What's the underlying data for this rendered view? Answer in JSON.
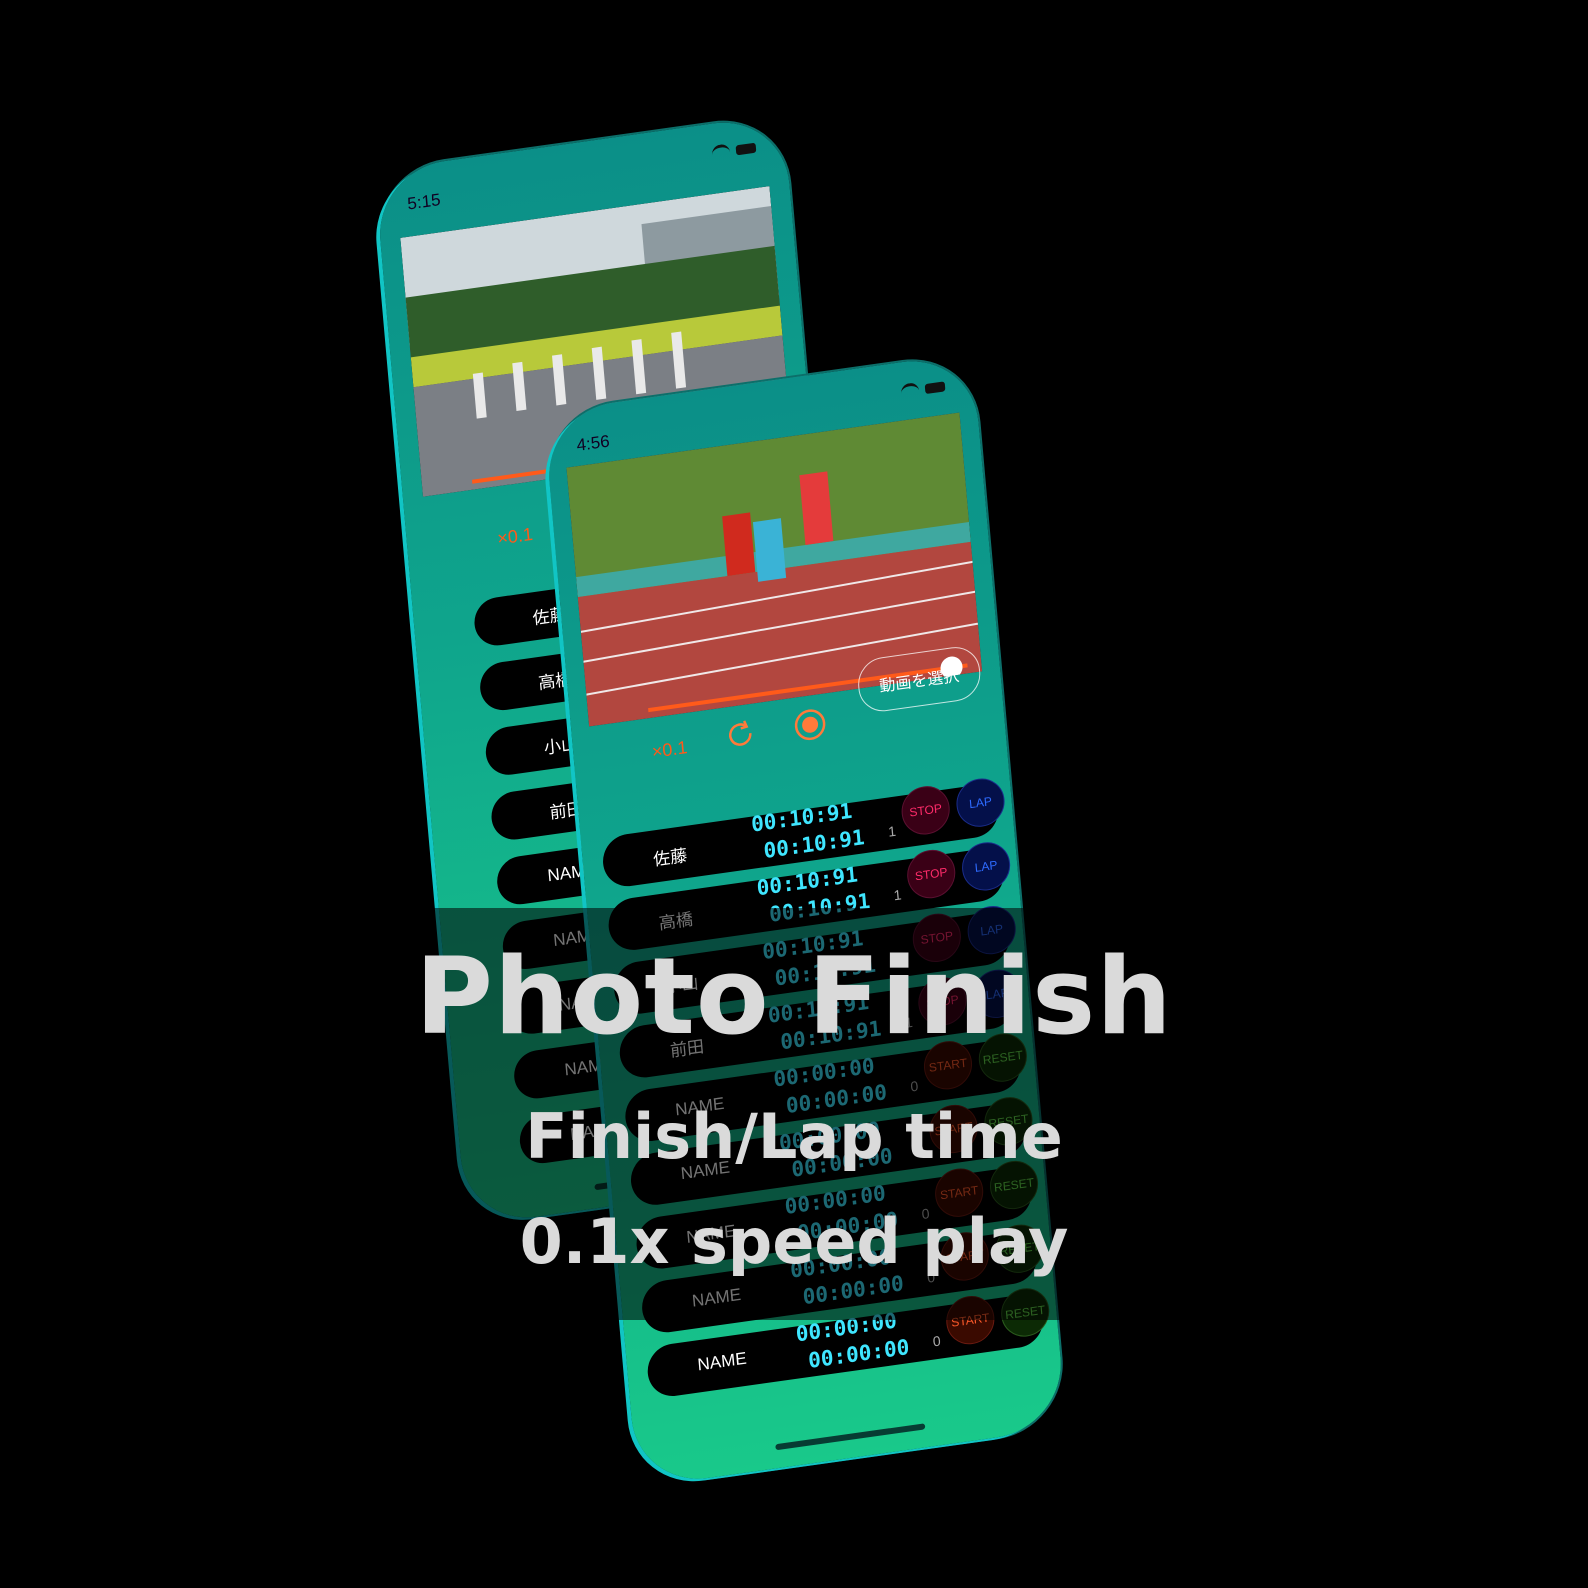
{
  "back_phone": {
    "status_time": "5:15",
    "speed": "×0.1",
    "rows": [
      "佐藤",
      "高橋",
      "小山",
      "前田",
      "NAME",
      "NAME",
      "NAME",
      "NAME",
      "NAME"
    ]
  },
  "front_phone": {
    "status_time": "4:56",
    "speed": "×0.1",
    "select_video_label": "動画を選択",
    "scrub_progress": 0.95,
    "rows": [
      {
        "name": "佐藤",
        "time_main": "00:10:91",
        "time_lap": "00:10:91",
        "lap_count": "1",
        "btn_left": "STOP",
        "btn_right": "LAP"
      },
      {
        "name": "高橋",
        "time_main": "00:10:91",
        "time_lap": "00:10:91",
        "lap_count": "1",
        "btn_left": "STOP",
        "btn_right": "LAP"
      },
      {
        "name": "小山",
        "time_main": "00:10:91",
        "time_lap": "00:10:91",
        "lap_count": "1",
        "btn_left": "STOP",
        "btn_right": "LAP"
      },
      {
        "name": "前田",
        "time_main": "00:10:91",
        "time_lap": "00:10:91",
        "lap_count": "1",
        "btn_left": "STOP",
        "btn_right": "LAP"
      },
      {
        "name": "NAME",
        "time_main": "00:00:00",
        "time_lap": "00:00:00",
        "lap_count": "0",
        "btn_left": "START",
        "btn_right": "RESET"
      },
      {
        "name": "NAME",
        "time_main": "00:00:00",
        "time_lap": "00:00:00",
        "lap_count": "0",
        "btn_left": "START",
        "btn_right": "RESET"
      },
      {
        "name": "NAME",
        "time_main": "00:00:00",
        "time_lap": "00:00:00",
        "lap_count": "0",
        "btn_left": "START",
        "btn_right": "RESET"
      },
      {
        "name": "NAME",
        "time_main": "00:00:00",
        "time_lap": "00:00:00",
        "lap_count": "0",
        "btn_left": "START",
        "btn_right": "RESET"
      },
      {
        "name": "NAME",
        "time_main": "00:00:00",
        "time_lap": "00:00:00",
        "lap_count": "0",
        "btn_left": "START",
        "btn_right": "RESET"
      }
    ]
  },
  "overlay": {
    "title": "Photo Finish",
    "line1": "Finish/Lap time",
    "line2": "0.1x speed play"
  },
  "colors": {
    "phone_top": "#0b8f88",
    "phone_bottom": "#19c98a",
    "digit": "#3fe6ff",
    "accent_orange": "#ff5a1a"
  }
}
